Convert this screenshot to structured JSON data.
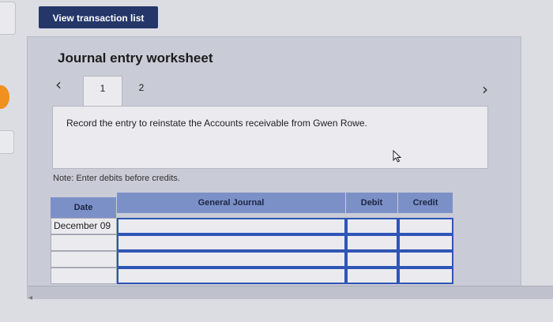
{
  "toolbar": {
    "view_transactions_label": "View transaction list"
  },
  "worksheet": {
    "title": "Journal entry worksheet",
    "tabs": [
      {
        "label": "1",
        "active": true
      },
      {
        "label": "2",
        "active": false
      }
    ],
    "prompt": "Record the entry to reinstate the Accounts receivable from Gwen Rowe.",
    "note": "Note: Enter debits before credits."
  },
  "journal": {
    "headers": {
      "date": "Date",
      "general_journal": "General Journal",
      "debit": "Debit",
      "credit": "Credit"
    },
    "rows": [
      {
        "date": "December 09",
        "account": "",
        "debit": "",
        "credit": ""
      },
      {
        "date": "",
        "account": "",
        "debit": "",
        "credit": ""
      },
      {
        "date": "",
        "account": "",
        "debit": "",
        "credit": ""
      },
      {
        "date": "",
        "account": "",
        "debit": "",
        "credit": ""
      }
    ]
  },
  "colors": {
    "button_bg": "#243768",
    "header_bg": "#7c90c8",
    "input_border": "#2f55b5"
  },
  "icons": {
    "prev": "chevron-left-icon",
    "next": "chevron-right-icon",
    "pointer": "mouse-pointer-icon"
  }
}
